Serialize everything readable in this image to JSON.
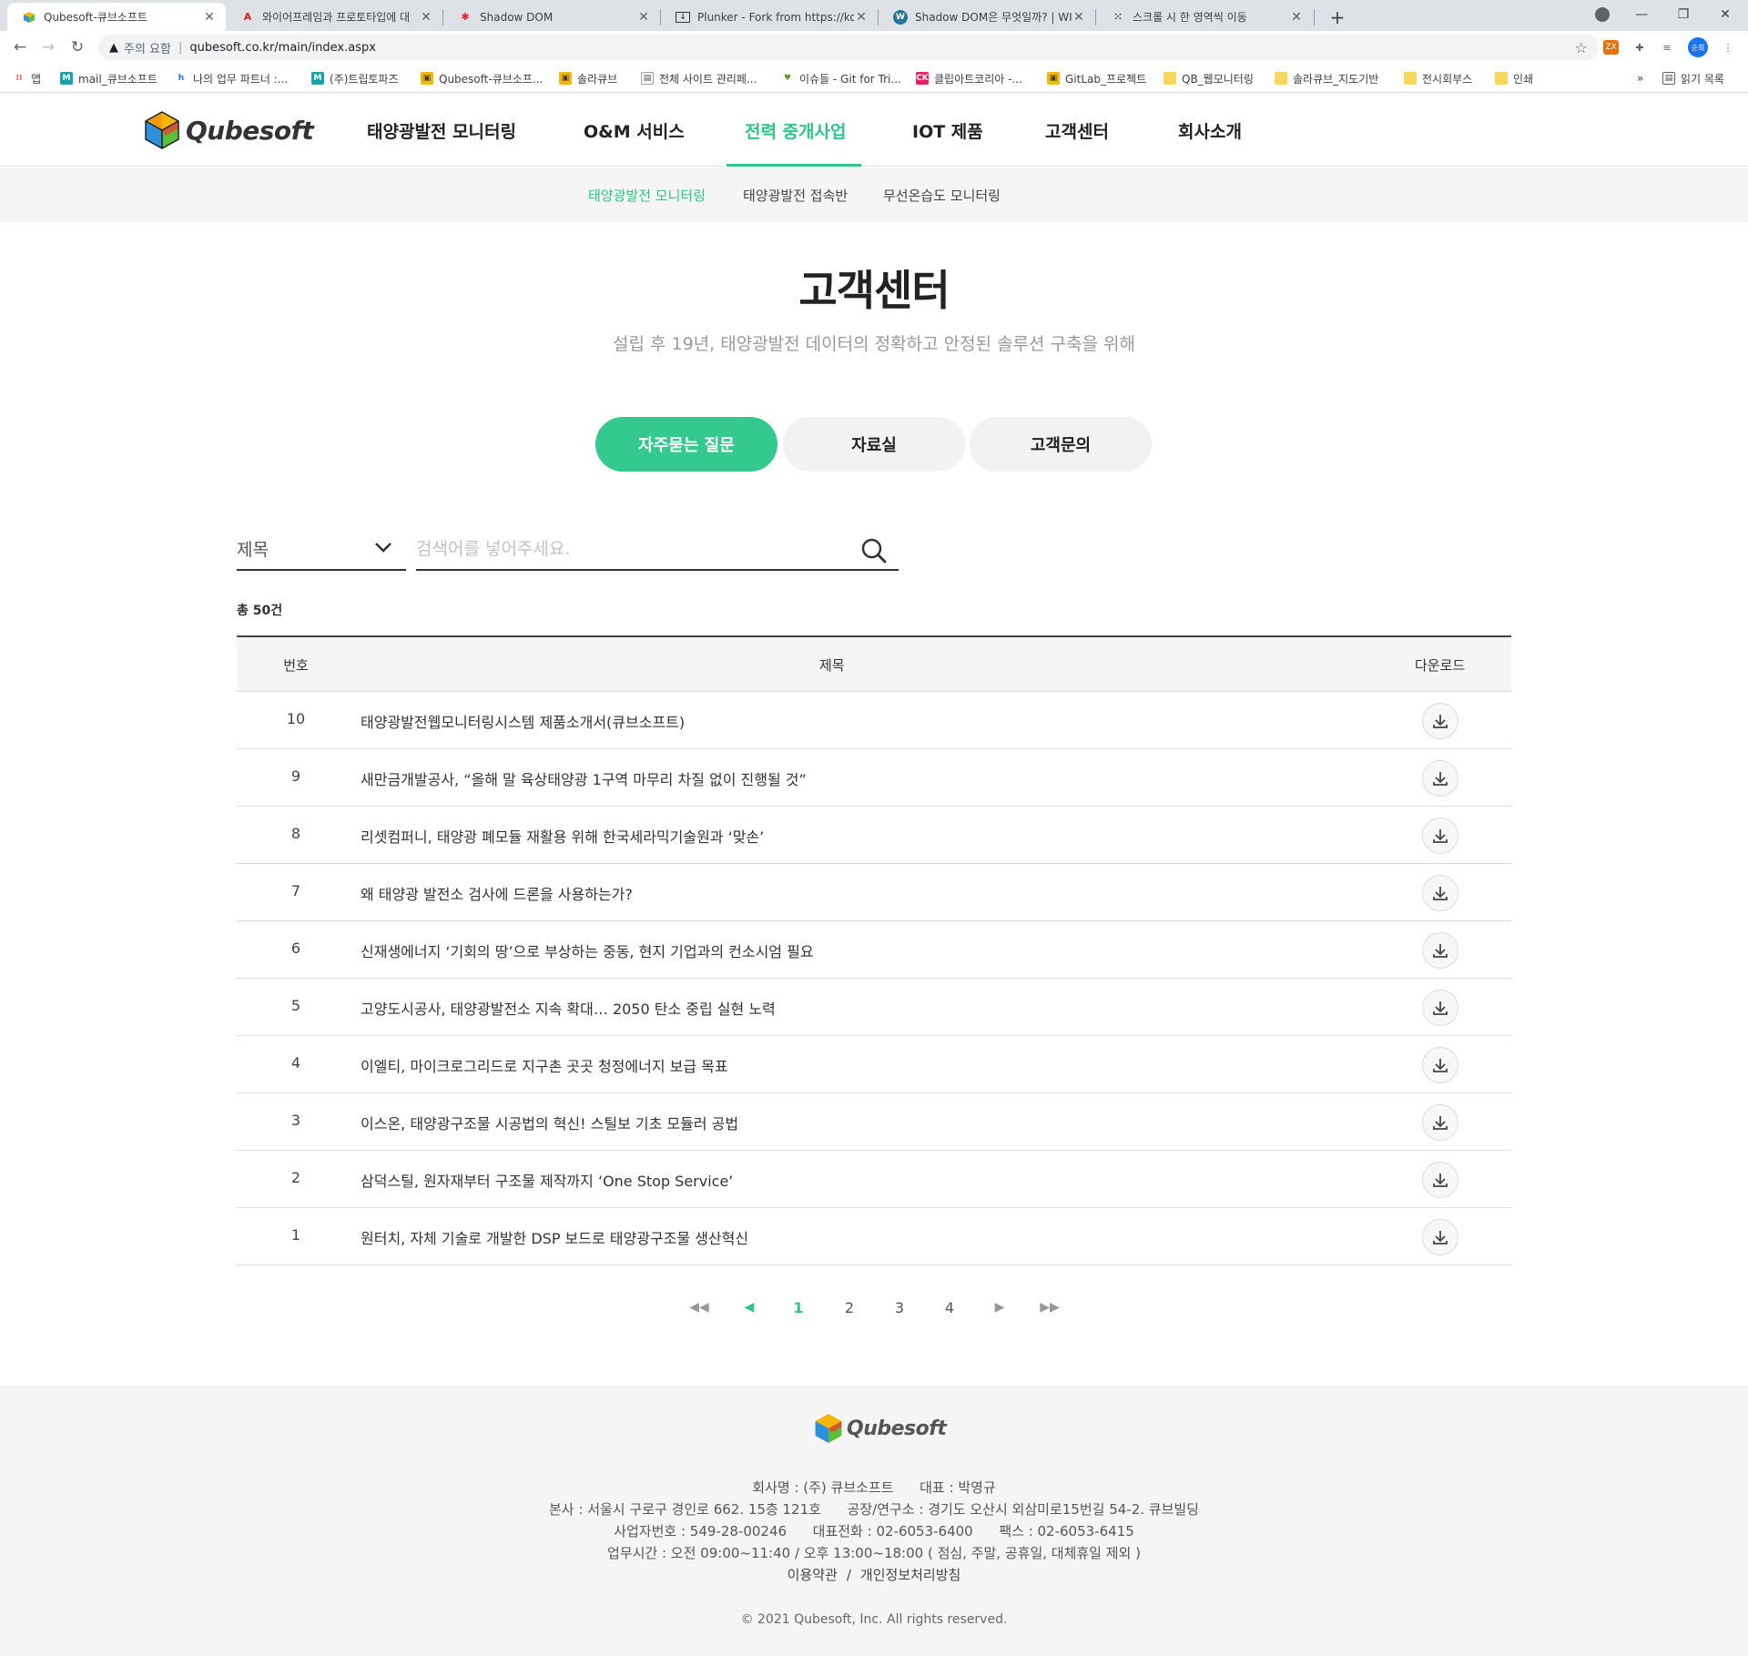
{
  "browser": {
    "tabs": [
      {
        "title": "Qubesoft-큐브소프트",
        "icon": "qubesoft-cube-icon",
        "active": true
      },
      {
        "title": "와이어프레임과 프로토타입에 대",
        "icon": "adobe-icon",
        "active": false
      },
      {
        "title": "Shadow DOM",
        "icon": "mdn-icon",
        "active": false
      },
      {
        "title": "Plunker - Fork from https://ko.ja",
        "icon": "plunker-icon",
        "active": false
      },
      {
        "title": "Shadow DOM은 무엇일까? | WI",
        "icon": "wordpress-icon",
        "active": false
      },
      {
        "title": "스크롤 시 한 영역씩 이동",
        "icon": "dots-icon",
        "active": false
      }
    ],
    "security_label": "주의 요함",
    "url": "qubesoft.co.kr/main/index.aspx",
    "profile_label": "순희",
    "bookmarks": [
      {
        "label": "앱"
      },
      {
        "label": "mail_큐브소프트"
      },
      {
        "label": "나의 업무 파트너 :..."
      },
      {
        "label": "(주)트립토파즈"
      },
      {
        "label": "Qubesoft-큐브소프..."
      },
      {
        "label": "솔라큐브"
      },
      {
        "label": "전체 사이트 관리페..."
      },
      {
        "label": "이슈들 - Git for Tri..."
      },
      {
        "label": "클립아트코리아 -..."
      },
      {
        "label": "GitLab_프로젝트"
      },
      {
        "label": "QB_웹모니터링"
      },
      {
        "label": "솔라큐브_지도기반"
      },
      {
        "label": "전시회부스"
      },
      {
        "label": "인쇄"
      }
    ],
    "more_label": "»",
    "reading_list_label": "읽기 목록"
  },
  "header": {
    "logo_text": "Qubesoft",
    "nav": [
      {
        "label": "태양광발전 모니터링",
        "active": false
      },
      {
        "label": "O&M 서비스",
        "active": false
      },
      {
        "label": "전력 중개사업",
        "active": true
      },
      {
        "label": "IOT 제품",
        "active": false
      },
      {
        "label": "고객센터",
        "active": false
      },
      {
        "label": "회사소개",
        "active": false
      }
    ],
    "subnav": [
      {
        "label": "태양광발전 모니터링",
        "active": true
      },
      {
        "label": "태양광발전 접속반",
        "active": false
      },
      {
        "label": "무선온습도 모니터링",
        "active": false
      }
    ]
  },
  "main": {
    "title": "고객센터",
    "subtitle": "설립 후 19년, 태양광발전 데이터의 정확하고 안정된 솔루션 구축을 위해",
    "tabs": [
      {
        "label": "자주묻는 질문",
        "active": true
      },
      {
        "label": "자료실",
        "active": false
      },
      {
        "label": "고객문의",
        "active": false
      }
    ],
    "search": {
      "select_value": "제목",
      "placeholder": "검색어를 넣어주세요.",
      "value": ""
    },
    "total_label": "총 50건",
    "table": {
      "headers": {
        "num": "번호",
        "title": "제목",
        "download": "다운로드"
      },
      "rows": [
        {
          "num": "10",
          "title": "태양광발전웹모니터링시스템 제품소개서(큐브소프트)"
        },
        {
          "num": "9",
          "title": "새만금개발공사, “올해 말 육상태양광 1구역 마무리 차질 없이 진행될 것”"
        },
        {
          "num": "8",
          "title": "리셋컴퍼니, 태양광 폐모듈 재활용 위해 한국세라믹기술원과 ‘맞손’"
        },
        {
          "num": "7",
          "title": "왜 태양광 발전소 검사에 드론을 사용하는가?"
        },
        {
          "num": "6",
          "title": "신재생에너지 ‘기회의 땅’으로 부상하는 중동, 현지 기업과의 컨소시엄 필요"
        },
        {
          "num": "5",
          "title": "고양도시공사, 태양광발전소 지속 확대… 2050 탄소 중립 실현 노력"
        },
        {
          "num": "4",
          "title": "이엘티, 마이크로그리드로 지구촌 곳곳 청정에너지 보급 목표"
        },
        {
          "num": "3",
          "title": "이스온, 태양광구조물 시공법의 혁신! 스틸보 기초 모듈러 공법"
        },
        {
          "num": "2",
          "title": "삼덕스틸, 원자재부터 구조물 제작까지 ‘One Stop Service’"
        },
        {
          "num": "1",
          "title": "원터치, 자체 기술로 개발한 DSP 보드로 태양광구조물 생산혁신"
        }
      ]
    },
    "pagination": {
      "first": "◀◀",
      "prev": "◀",
      "pages": [
        "1",
        "2",
        "3",
        "4"
      ],
      "current": "1",
      "next": "▶",
      "last": "▶▶"
    }
  },
  "footer": {
    "logo_text": "Qubesoft",
    "line1": "회사명 : (주) 큐브소프트      대표 : 박영규",
    "line2": "본사 : 서울시 구로구 경인로 662. 15층 121호      공장/연구소 : 경기도 오산시 외삼미로15번길 54-2. 큐브빌딩",
    "line3": "사업자번호 : 549-28-00246      대표전화 : 02-6053-6400      팩스 : 02-6053-6415",
    "line4": "업무시간 : 오전 09:00~11:40 / 오후 13:00~18:00 ( 점심, 주말, 공휴일, 대체휴일 제외 )",
    "links": [
      {
        "label": "이용약관"
      },
      {
        "label": "개인정보처리방침"
      }
    ],
    "link_separator": "/",
    "copyright": "© 2021 Qubesoft, Inc. All rights reserved."
  },
  "colors": {
    "accent": "#2fc58a",
    "tab_active": "#34c98e",
    "footer_bg": "#f5f5f5"
  }
}
